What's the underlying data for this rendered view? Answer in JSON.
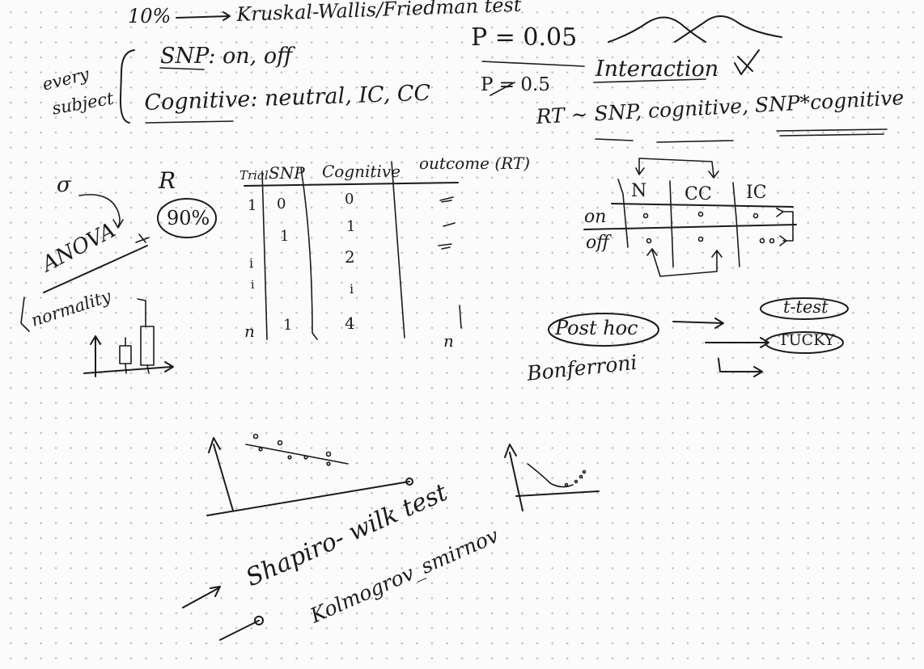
{
  "notes": {
    "top_line": {
      "percent": "10%",
      "tests": "Kruskal-Wallis/Friedman test"
    },
    "every_subject": {
      "label_1": "every",
      "label_2": "subject"
    },
    "snp_line": "SNP: on, off",
    "cognitive_line": "Cognitive: neutral, IC, CC",
    "p_value": "P = 0.05",
    "p_struck": "P = 0.5",
    "interaction": "Interaction",
    "model": {
      "prefix": "RT ~ ",
      "snp": "SNP",
      "sep1": ", ",
      "cognitive": "cognitive",
      "sep2": ", ",
      "interaction_term": "SNP*cognitive"
    },
    "r_label": "R",
    "sigma": "σ",
    "anova": "ANOVA",
    "percent_90": "90%",
    "normality": "normality",
    "table": {
      "headers": [
        "Trial",
        "SNP",
        "Cognitive",
        "outcome (RT)"
      ],
      "col_trial": [
        "1",
        "",
        "i",
        "i",
        "n"
      ],
      "col_snp": [
        "0",
        "",
        "1",
        "",
        "1"
      ],
      "col_cog": [
        "0",
        "1",
        "2",
        "i",
        "4"
      ],
      "col_outcome_end": "n"
    },
    "grid": {
      "col_headers": [
        "N",
        "CC",
        "IC"
      ],
      "row_headers": [
        "on",
        "off"
      ]
    },
    "post_hoc": "Post hoc",
    "t_test": "t-test",
    "tucky": "TUCKY",
    "bonferroni": "Bonferroni",
    "shapiro": "Shapiro- wilk test",
    "kolmogorov": "Kolmogrov_smirnov"
  }
}
